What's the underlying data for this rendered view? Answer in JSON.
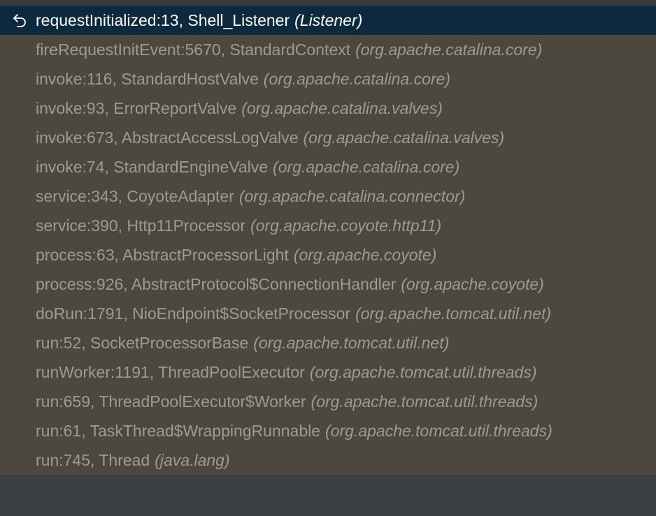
{
  "frames": [
    {
      "method": "requestInitialized:13, Shell_Listener",
      "pkg": "(Listener)",
      "selected": true,
      "icon": "step-back-icon"
    },
    {
      "method": "fireRequestInitEvent:5670, StandardContext",
      "pkg": "(org.apache.catalina.core)"
    },
    {
      "method": "invoke:116, StandardHostValve",
      "pkg": "(org.apache.catalina.core)"
    },
    {
      "method": "invoke:93, ErrorReportValve",
      "pkg": "(org.apache.catalina.valves)"
    },
    {
      "method": "invoke:673, AbstractAccessLogValve",
      "pkg": "(org.apache.catalina.valves)"
    },
    {
      "method": "invoke:74, StandardEngineValve",
      "pkg": "(org.apache.catalina.core)"
    },
    {
      "method": "service:343, CoyoteAdapter",
      "pkg": "(org.apache.catalina.connector)"
    },
    {
      "method": "service:390, Http11Processor",
      "pkg": "(org.apache.coyote.http11)"
    },
    {
      "method": "process:63, AbstractProcessorLight",
      "pkg": "(org.apache.coyote)"
    },
    {
      "method": "process:926, AbstractProtocol$ConnectionHandler",
      "pkg": "(org.apache.coyote)"
    },
    {
      "method": "doRun:1791, NioEndpoint$SocketProcessor",
      "pkg": "(org.apache.tomcat.util.net)"
    },
    {
      "method": "run:52, SocketProcessorBase",
      "pkg": "(org.apache.tomcat.util.net)"
    },
    {
      "method": "runWorker:1191, ThreadPoolExecutor",
      "pkg": "(org.apache.tomcat.util.threads)"
    },
    {
      "method": "run:659, ThreadPoolExecutor$Worker",
      "pkg": "(org.apache.tomcat.util.threads)"
    },
    {
      "method": "run:61, TaskThread$WrappingRunnable",
      "pkg": "(org.apache.tomcat.util.threads)"
    },
    {
      "method": "run:745, Thread",
      "pkg": "(java.lang)"
    }
  ],
  "colors": {
    "panel_bg": "#4d483f",
    "selected_bg": "#0d293e",
    "text": "#9f9a90",
    "selected_text": "#ffffff"
  }
}
